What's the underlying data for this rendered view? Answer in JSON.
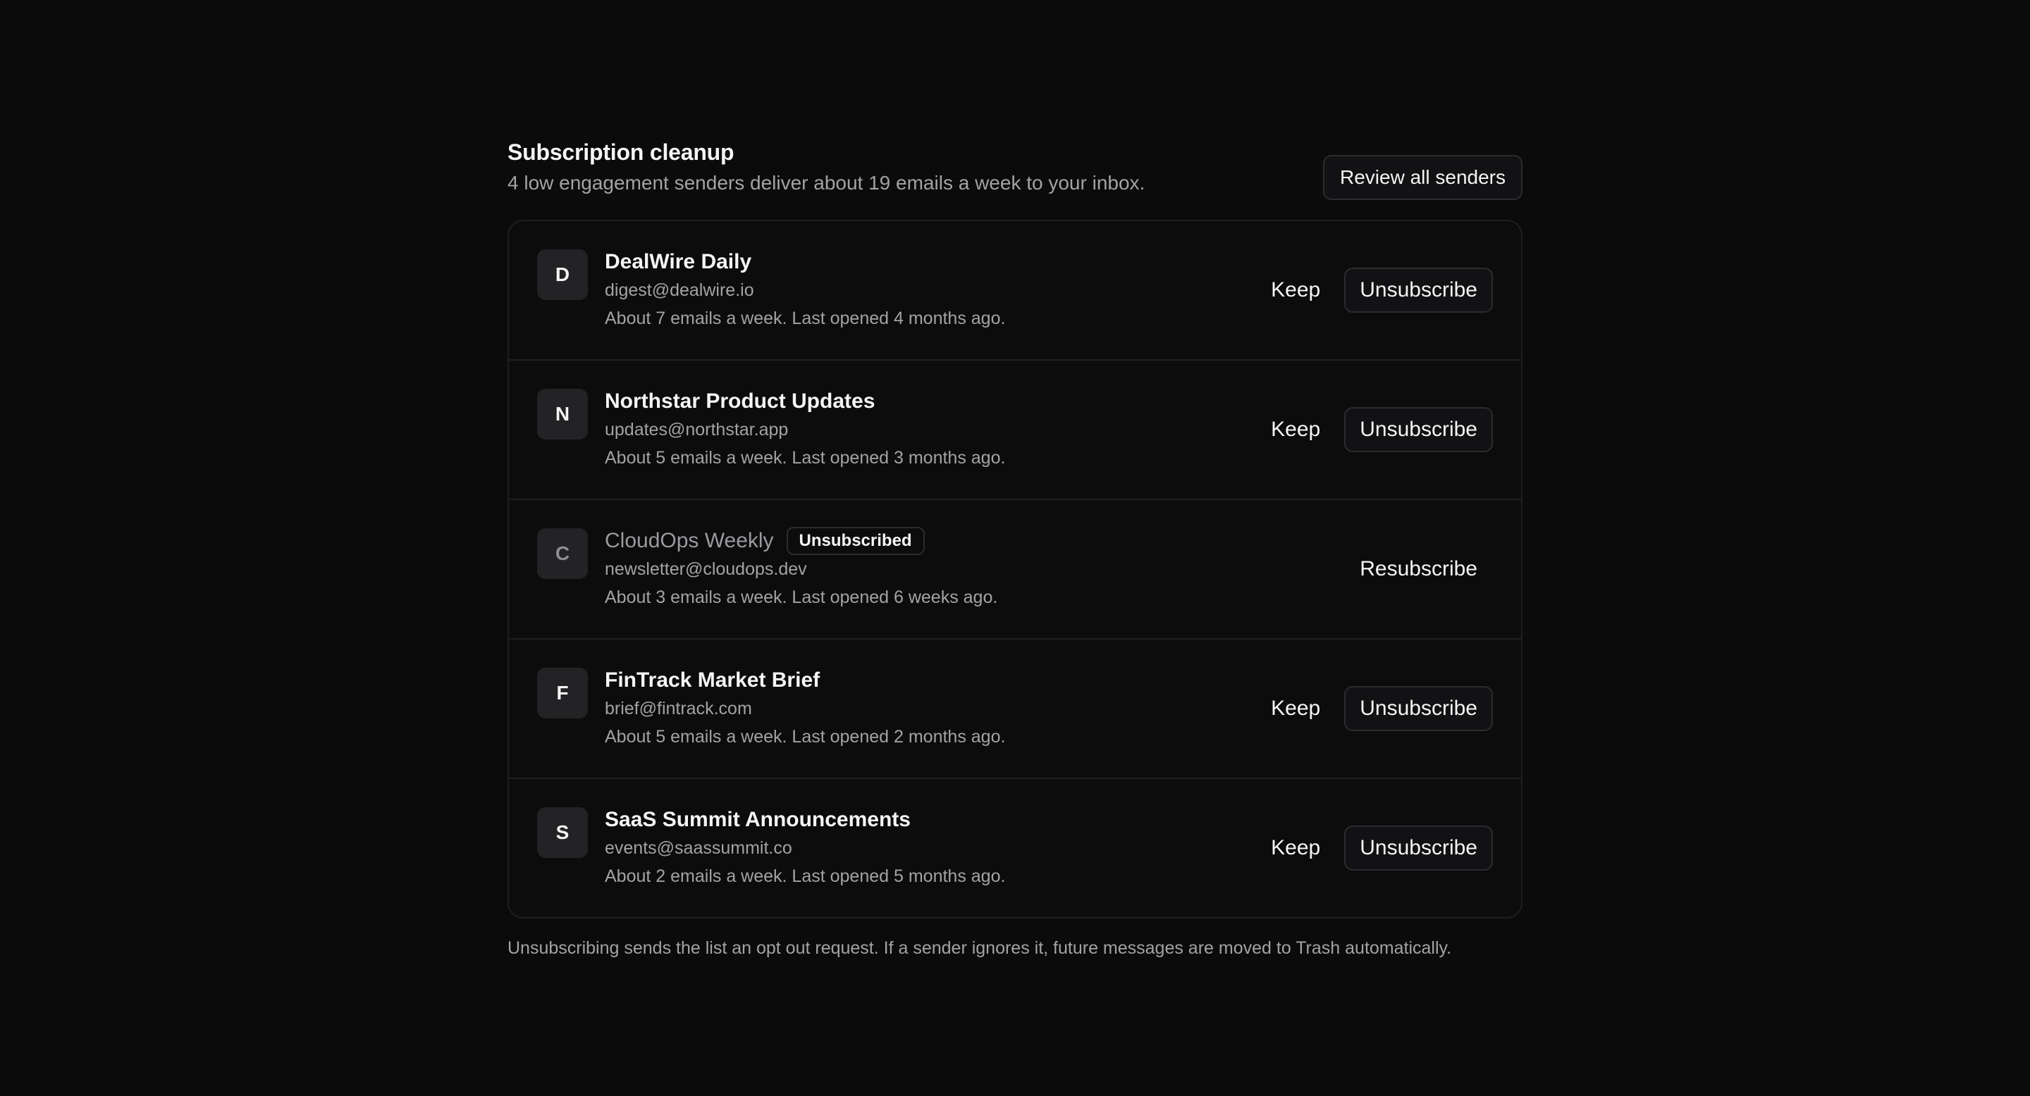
{
  "header": {
    "title": "Subscription cleanup",
    "subtitle": "4 low engagement senders deliver about 19 emails a week to your inbox.",
    "review_label": "Review all senders"
  },
  "senders": [
    {
      "initial": "D",
      "name": "DealWire Daily",
      "email": "digest@dealwire.io",
      "meta": "About 7 emails a week. Last opened 4 months ago.",
      "keep_label": "Keep",
      "unsubscribe_label": "Unsubscribe"
    },
    {
      "initial": "N",
      "name": "Northstar Product Updates",
      "email": "updates@northstar.app",
      "meta": "About 5 emails a week. Last opened 3 months ago.",
      "keep_label": "Keep",
      "unsubscribe_label": "Unsubscribe"
    },
    {
      "initial": "C",
      "name": "CloudOps Weekly",
      "badge": "Unsubscribed",
      "email": "newsletter@cloudops.dev",
      "meta": "About 3 emails a week. Last opened 6 weeks ago.",
      "resubscribe_label": "Resubscribe"
    },
    {
      "initial": "F",
      "name": "FinTrack Market Brief",
      "email": "brief@fintrack.com",
      "meta": "About 5 emails a week. Last opened 2 months ago.",
      "keep_label": "Keep",
      "unsubscribe_label": "Unsubscribe"
    },
    {
      "initial": "S",
      "name": "SaaS Summit Announcements",
      "email": "events@saassummit.co",
      "meta": "About 2 emails a week. Last opened 5 months ago.",
      "keep_label": "Keep",
      "unsubscribe_label": "Unsubscribe"
    }
  ],
  "footnote": "Unsubscribing sends the list an opt out request. If a sender ignores it, future messages are moved to Trash automatically.",
  "colors": {
    "background": "#0b0b0c",
    "card": "#0c0c0d",
    "border": "#1f1f22",
    "avatar": "#232326",
    "text_primary": "#f5f5f5",
    "text_secondary": "#a3a3a3"
  }
}
